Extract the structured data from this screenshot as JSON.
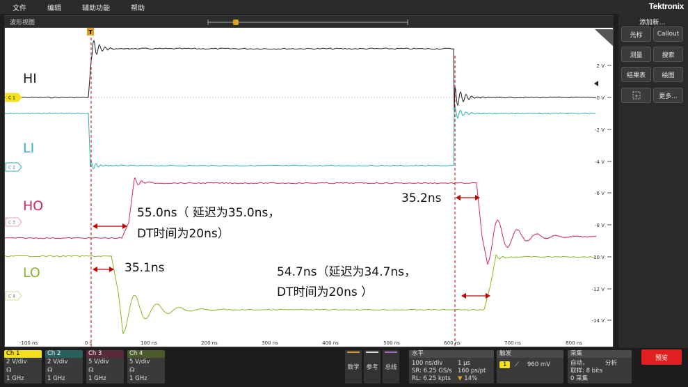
{
  "menu": {
    "items": [
      "文件",
      "编辑",
      "辅助功能",
      "帮助"
    ],
    "brand": "Tektronix"
  },
  "waveform_view": {
    "title": "波形视图",
    "trigger_marker": "T",
    "y_tick_labels": [
      "2 V",
      "0 V",
      "-2 V",
      "-4 V",
      "-6 V",
      "-8 V",
      "-10 V",
      "-12 V",
      "-14 V"
    ],
    "x_tick_labels": [
      "-100 ns",
      "0 s",
      "100 ns",
      "200 ns",
      "300 ns",
      "400 ns",
      "500 ns",
      "600 ns",
      "700 ns",
      "800 ns"
    ],
    "channel_markers": [
      "C 1",
      "C 2",
      "C 3",
      "C 4"
    ],
    "signal_labels": [
      "HI",
      "LI",
      "HO",
      "LO"
    ],
    "annotations": {
      "ho_rise": "55.0ns（ 延迟为35.0ns，",
      "ho_rise_2": "DT时间为20ns）",
      "lo_fall": "35.1ns",
      "ho_fall": "35.2ns",
      "lo_rise": "54.7ns（延迟为34.7ns，",
      "lo_rise_2": "DT时间为20ns ）"
    },
    "colors": {
      "ch1": "#1a1a1a",
      "ch2": "#2ab3b8",
      "ch3": "#d0285a",
      "ch4": "#8ab627",
      "arrow": "#c00000"
    }
  },
  "right_panel": {
    "title": "添加新...",
    "buttons": [
      "光标",
      "Callout",
      "测量",
      "搜索",
      "结果表",
      "绘图",
      "更多..."
    ]
  },
  "channels": [
    {
      "name": "Ch 1",
      "scale": "2 V/div",
      "bw": "1 GHz",
      "color": "#f4e01f"
    },
    {
      "name": "Ch 2",
      "scale": "2 V/div",
      "bw": "1 GHz",
      "color": "#2ab3b8"
    },
    {
      "name": "Ch 3",
      "scale": "5 V/div",
      "bw": "1 GHz",
      "color": "#d0285a"
    },
    {
      "name": "Ch 4",
      "scale": "5 V/div",
      "bw": "1 GHz",
      "color": "#8ab627"
    }
  ],
  "bottom_buttons": [
    "数学",
    "参考",
    "总线"
  ],
  "horizontal": {
    "title": "水平",
    "scale": "100 ns/div",
    "record_length_time": "1 μs",
    "sample_rate": "SR: 6.25 GS/s",
    "resolution": "160 ps/pt",
    "record_length": "RL: 6.25 kpts",
    "position": "14%"
  },
  "trigger": {
    "title": "触发",
    "source": "1",
    "level": "960 mV"
  },
  "acquisition": {
    "title": "采集",
    "mode": "自动，",
    "analyze": "分析",
    "sampling": "取样: 8 bits",
    "count": "0 采集"
  },
  "stop_button": "预览"
}
